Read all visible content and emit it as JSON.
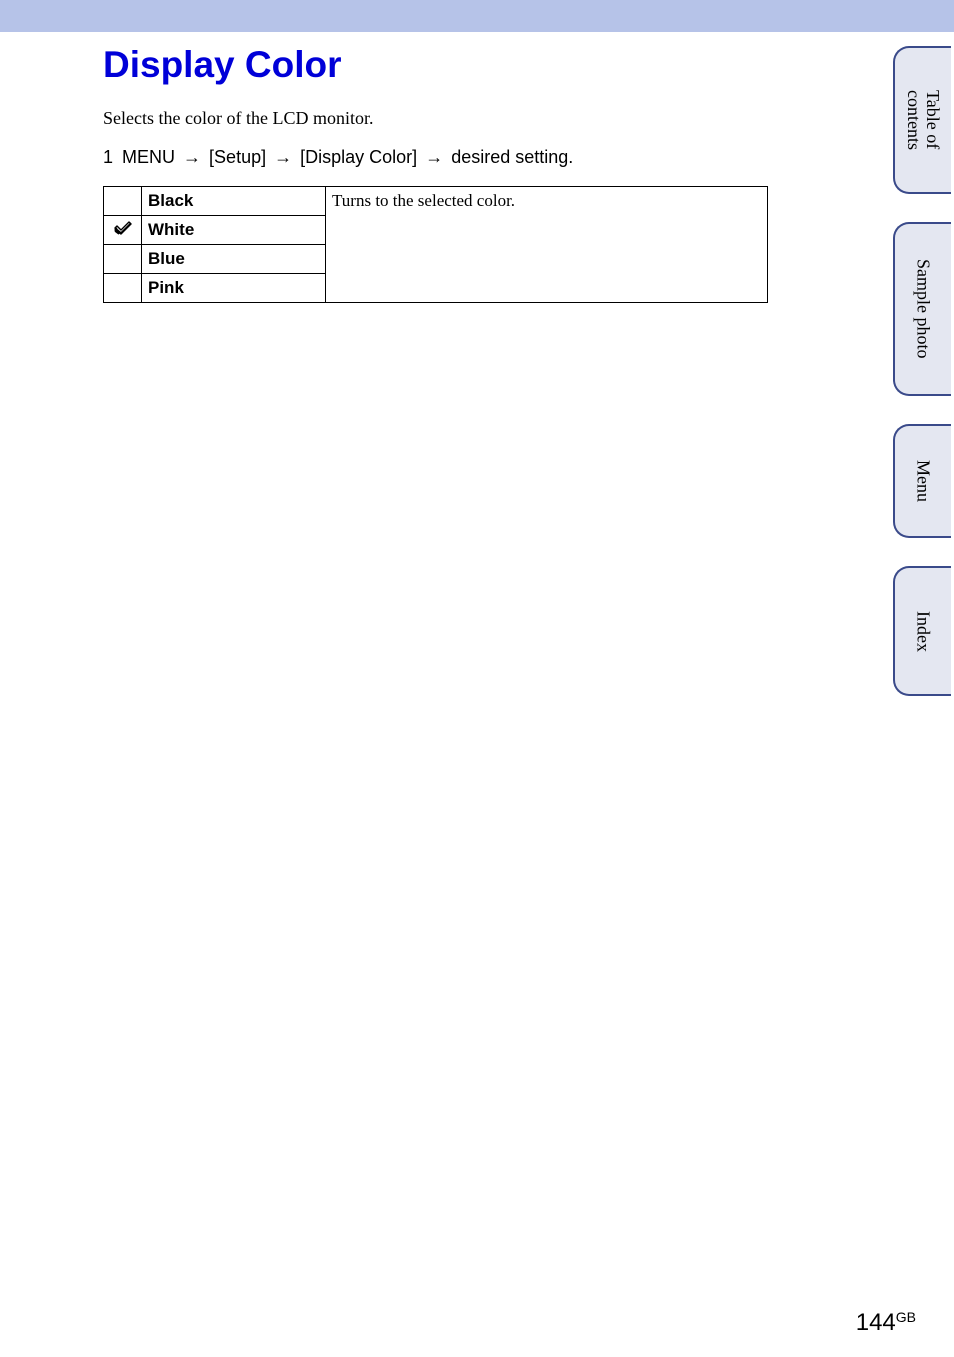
{
  "title": "Display Color",
  "intro": "Selects the color of the LCD monitor.",
  "step": {
    "number": "1",
    "menu_label": "MENU",
    "path_1": "[Setup]",
    "path_2": "[Display Color]",
    "final": "desired setting."
  },
  "options": {
    "description": "Turns to the selected color.",
    "rows": [
      {
        "checked": false,
        "name": "Black"
      },
      {
        "checked": true,
        "name": "White"
      },
      {
        "checked": false,
        "name": "Blue"
      },
      {
        "checked": false,
        "name": "Pink"
      }
    ]
  },
  "tabs": {
    "toc": "Table of \ncontents",
    "sample": "Sample photo",
    "menu": "Menu",
    "index": "Index"
  },
  "page": {
    "number": "144",
    "suffix": "GB"
  }
}
